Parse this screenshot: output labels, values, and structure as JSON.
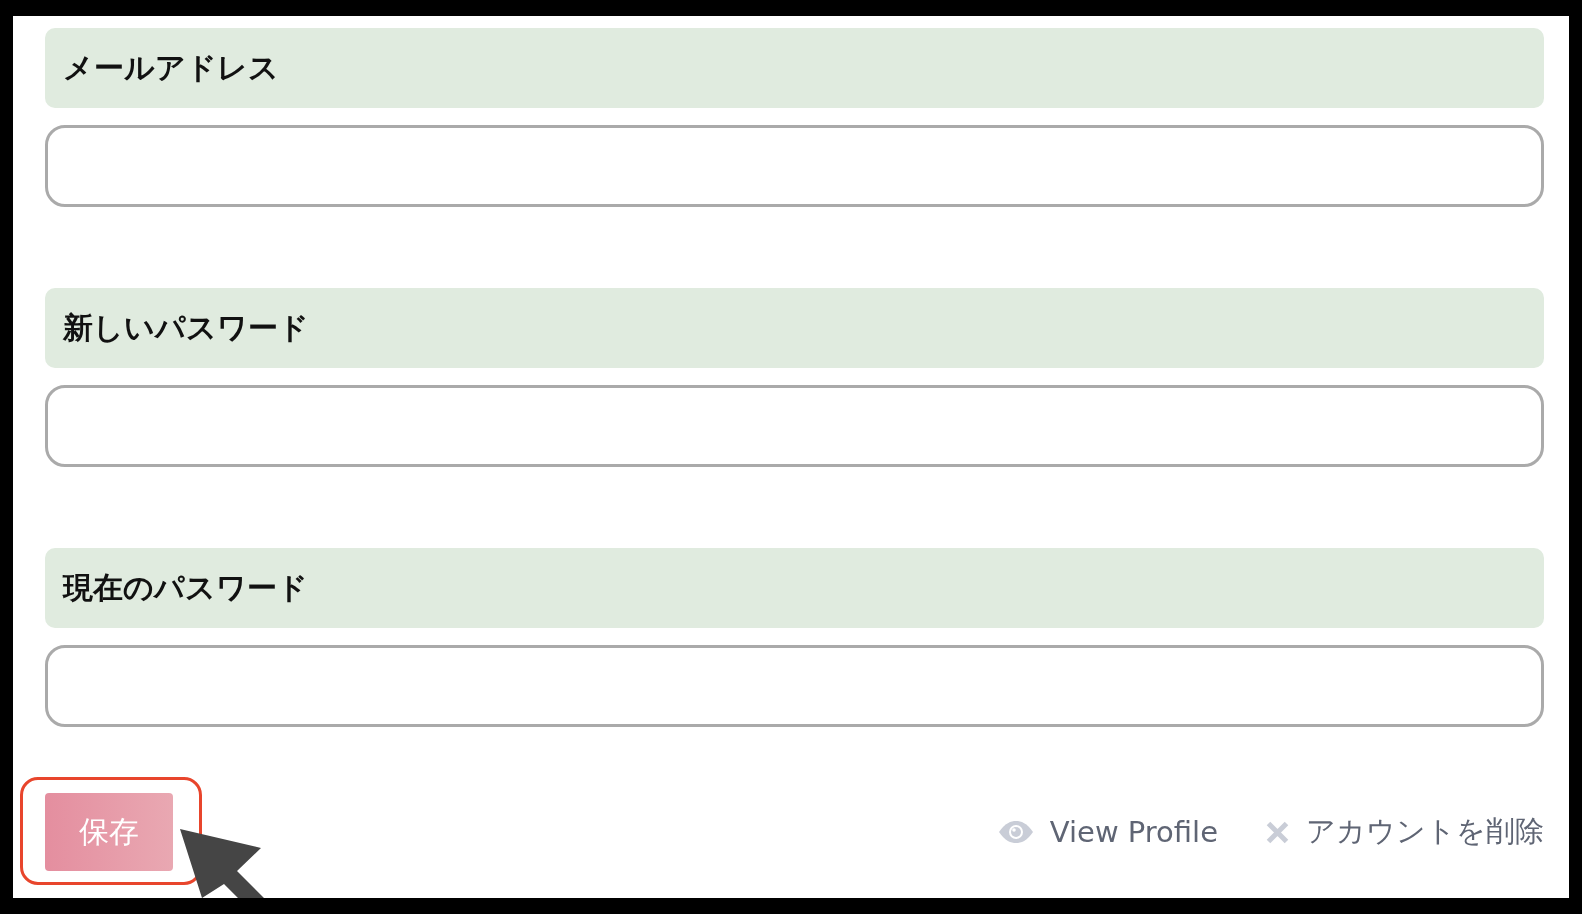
{
  "fields": [
    {
      "label": "メールアドレス"
    },
    {
      "label": "新しいパスワード"
    },
    {
      "label": "現在のパスワード"
    }
  ],
  "save_button": {
    "label": "保存",
    "highlighted": true,
    "hovered": true
  },
  "links": [
    {
      "kind": "view",
      "label": "View Profile"
    },
    {
      "kind": "delete",
      "label": "アカウントを削除"
    }
  ]
}
